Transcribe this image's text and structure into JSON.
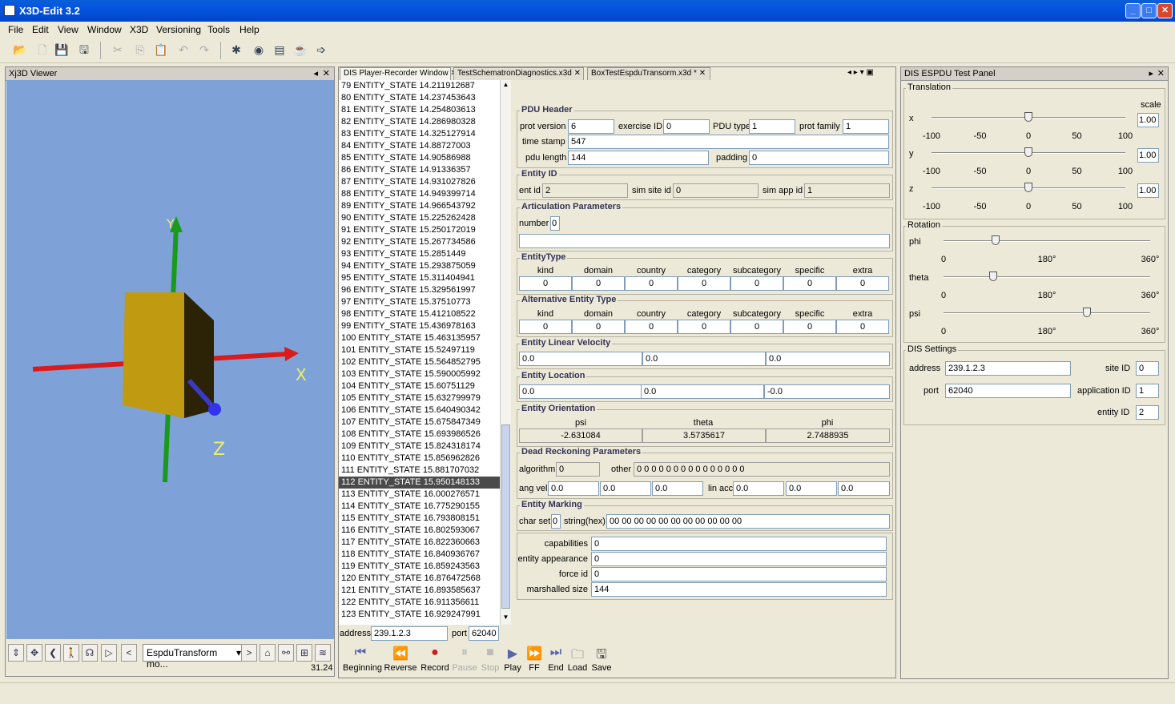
{
  "window": {
    "title": "X3D-Edit 3.2"
  },
  "menu": [
    "File",
    "Edit",
    "View",
    "Window",
    "X3D",
    "Versioning",
    "Tools",
    "Help"
  ],
  "viewer": {
    "title": "Xj3D Viewer",
    "axis_x": "X",
    "axis_y": "Y",
    "axis_z": "Z",
    "viewpoint": "EspduTransform mo...",
    "fps": "31.24"
  },
  "tabs": [
    "DIS Player-Recorder Window",
    "TestSchematronDiagnostics.x3d",
    "BoxTestEspduTransorm.x3d *"
  ],
  "pdu_list": [
    "79 ENTITY_STATE 14.211912687",
    "80 ENTITY_STATE 14.237453643",
    "81 ENTITY_STATE 14.254803613",
    "82 ENTITY_STATE 14.286980328",
    "83 ENTITY_STATE 14.325127914",
    "84 ENTITY_STATE 14.88727003",
    "85 ENTITY_STATE 14.90586988",
    "86 ENTITY_STATE 14.91336357",
    "87 ENTITY_STATE 14.931027826",
    "88 ENTITY_STATE 14.949399714",
    "89 ENTITY_STATE 14.966543792",
    "90 ENTITY_STATE 15.225262428",
    "91 ENTITY_STATE 15.250172019",
    "92 ENTITY_STATE 15.267734586",
    "93 ENTITY_STATE 15.2851449",
    "94 ENTITY_STATE 15.293875059",
    "95 ENTITY_STATE 15.311404941",
    "96 ENTITY_STATE 15.329561997",
    "97 ENTITY_STATE 15.37510773",
    "98 ENTITY_STATE 15.412108522",
    "99 ENTITY_STATE 15.436978163",
    "100 ENTITY_STATE 15.463135957",
    "101 ENTITY_STATE 15.52497119",
    "102 ENTITY_STATE 15.564852795",
    "103 ENTITY_STATE 15.590005992",
    "104 ENTITY_STATE 15.60751129",
    "105 ENTITY_STATE 15.632799979",
    "106 ENTITY_STATE 15.640490342",
    "107 ENTITY_STATE 15.675847349",
    "108 ENTITY_STATE 15.693986526",
    "109 ENTITY_STATE 15.824318174",
    "110 ENTITY_STATE 15.856962826",
    "111 ENTITY_STATE 15.881707032",
    "112 ENTITY_STATE 15.950148133",
    "113 ENTITY_STATE 16.000276571",
    "114 ENTITY_STATE 16.775290155",
    "115 ENTITY_STATE 16.793808151",
    "116 ENTITY_STATE 16.802593067",
    "117 ENTITY_STATE 16.822360663",
    "118 ENTITY_STATE 16.840936767",
    "119 ENTITY_STATE 16.859243563",
    "120 ENTITY_STATE 16.876472568",
    "121 ENTITY_STATE 16.893585637",
    "122 ENTITY_STATE 16.911356611",
    "123 ENTITY_STATE 16.929247991"
  ],
  "selected_pdu": 33,
  "pdu_header": {
    "title": "PDU Header",
    "prot_version_l": "prot version",
    "prot_version": "6",
    "exercise_id_l": "exercise ID",
    "exercise_id": "0",
    "pdu_type_l": "PDU type",
    "pdu_type": "1",
    "prot_family_l": "prot family",
    "prot_family": "1",
    "time_stamp_l": "time stamp",
    "time_stamp": "547",
    "pdu_length_l": "pdu length",
    "pdu_length": "144",
    "padding_l": "padding",
    "padding": "0"
  },
  "entity_id": {
    "title": "Entity ID",
    "ent_id_l": "ent id",
    "ent_id": "2",
    "site_l": "sim site id",
    "site": "0",
    "app_l": "sim app id",
    "app": "1"
  },
  "articulation": {
    "title": "Articulation Parameters",
    "number_l": "number",
    "number": "0"
  },
  "type_cols": [
    "kind",
    "domain",
    "country",
    "category",
    "subcategory",
    "specific",
    "extra"
  ],
  "entity_type": {
    "title": "EntityType",
    "values": [
      "0",
      "0",
      "0",
      "0",
      "0",
      "0",
      "0"
    ]
  },
  "alt_entity_type": {
    "title": "Alternative Entity Type",
    "values": [
      "0",
      "0",
      "0",
      "0",
      "0",
      "0",
      "0"
    ]
  },
  "linear_velocity": {
    "title": "Entity Linear Velocity",
    "values": [
      "0.0",
      "0.0",
      "0.0"
    ]
  },
  "location": {
    "title": "Entity Location",
    "values": [
      "0.0",
      "0.0",
      "-0.0"
    ]
  },
  "orientation": {
    "title": "Entity Orientation",
    "labels": [
      "psi",
      "theta",
      "phi"
    ],
    "values": [
      "-2.631084",
      "3.5735617",
      "2.7488935"
    ]
  },
  "dead_reckoning": {
    "title": "Dead Reckoning Parameters",
    "algorithm_l": "algorithm",
    "algorithm": "0",
    "other_l": "other",
    "other": "0 0 0 0 0 0 0 0 0 0 0 0 0 0 0",
    "ang_vel_l": "ang vel",
    "ang_vel": [
      "0.0",
      "0.0",
      "0.0"
    ],
    "lin_acc_l": "lin acc",
    "lin_acc": [
      "0.0",
      "0.0",
      "0.0"
    ]
  },
  "marking": {
    "title": "Entity Marking",
    "charset_l": "char set",
    "charset": "0",
    "string_l": "string(hex)",
    "string": "00  00  00  00  00  00  00  00  00  00  00"
  },
  "misc": {
    "capabilities_l": "capabilities",
    "capabilities": "0",
    "appearance_l": "entity appearance",
    "appearance": "0",
    "force_l": "force id",
    "force": "0",
    "marshalled_l": "marshalled size",
    "marshalled": "144"
  },
  "network": {
    "address_l": "address",
    "address": "239.1.2.3",
    "port_l": "port",
    "port": "62040"
  },
  "controls": [
    "Beginning",
    "Reverse",
    "Record",
    "Pause",
    "Stop",
    "Play",
    "FF",
    "End",
    "Load",
    "Save"
  ],
  "espdu": {
    "title": "DIS ESPDU Test Panel",
    "translation_title": "Translation",
    "scale_l": "scale",
    "trans_ticks": [
      "-100",
      "-50",
      "0",
      "50",
      "100"
    ],
    "axes": [
      {
        "name": "x",
        "value": 0,
        "scale": "1.00"
      },
      {
        "name": "y",
        "value": 0,
        "scale": "1.00"
      },
      {
        "name": "z",
        "value": 0,
        "scale": "1.00"
      }
    ],
    "rotation_title": "Rotation",
    "rot_ticks": [
      "0",
      "180°",
      "360°"
    ],
    "rotations": [
      {
        "name": "phi",
        "value": 90
      },
      {
        "name": "theta",
        "value": 86
      },
      {
        "name": "psi",
        "value": 250
      }
    ],
    "dis_title": "DIS Settings",
    "address_l": "address",
    "address": "239.1.2.3",
    "port_l": "port",
    "port": "62040",
    "site_l": "site ID",
    "site": "0",
    "app_l": "application ID",
    "app": "1",
    "entity_l": "entity ID",
    "entity": "2"
  }
}
